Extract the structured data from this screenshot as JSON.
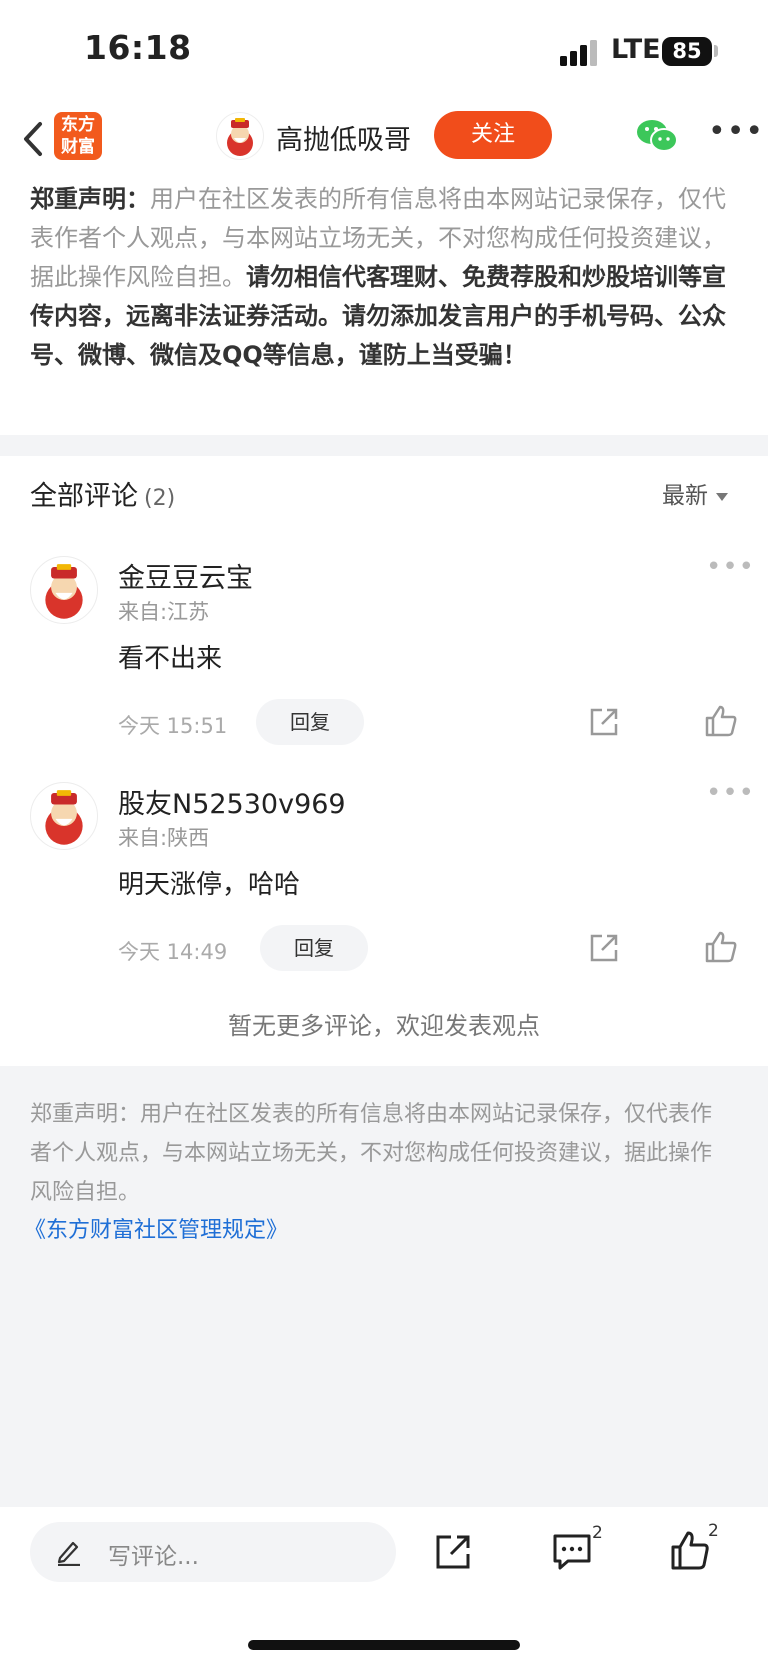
{
  "status_bar": {
    "time": "16:18",
    "network": "LTE",
    "battery": "85"
  },
  "navbar": {
    "logo_line1": "东方",
    "logo_line2": "财富",
    "author": "高抛低吸哥",
    "follow_label": "关注"
  },
  "disclaimer_top": {
    "lead": "郑重声明：",
    "normal": "用户在社区发表的所有信息将由本网站记录保存，仅代表作者个人观点，与本网站立场无关，不对您构成任何投资建议，据此操作风险自担。",
    "bold": "请勿相信代客理财、免费荐股和炒股培训等宣传内容，远离非法证券活动。请勿添加发言用户的手机号码、公众号、微博、微信及QQ等信息，谨防上当受骗！"
  },
  "comments": {
    "title": "全部评论",
    "count": "(2)",
    "sort_label": "最新",
    "items": [
      {
        "name": "金豆豆云宝",
        "location": "来自:江苏",
        "text": "看不出来",
        "time": "今天 15:51",
        "reply_label": "回复"
      },
      {
        "name": "股友N52530v969",
        "location": "来自:陕西",
        "text": "明天涨停，哈哈",
        "time": "今天 14:49",
        "reply_label": "回复"
      }
    ],
    "no_more": "暂无更多评论，欢迎发表观点"
  },
  "disclaimer_bottom": {
    "text": "郑重声明：用户在社区发表的所有信息将由本网站记录保存，仅代表作者个人观点，与本网站立场无关，不对您构成任何投资建议，据此操作风险自担。",
    "link": "《东方财富社区管理规定》"
  },
  "bottom_bar": {
    "placeholder": "写评论...",
    "comment_count": "2",
    "like_count": "2"
  },
  "colors": {
    "accent": "#f14d1b",
    "link": "#1f6fd6",
    "wechat": "#3cc75a"
  },
  "icons": [
    "back-arrow-icon",
    "wechat-icon",
    "more-icon",
    "share-icon",
    "like-icon",
    "comment-icon",
    "pencil-icon"
  ]
}
